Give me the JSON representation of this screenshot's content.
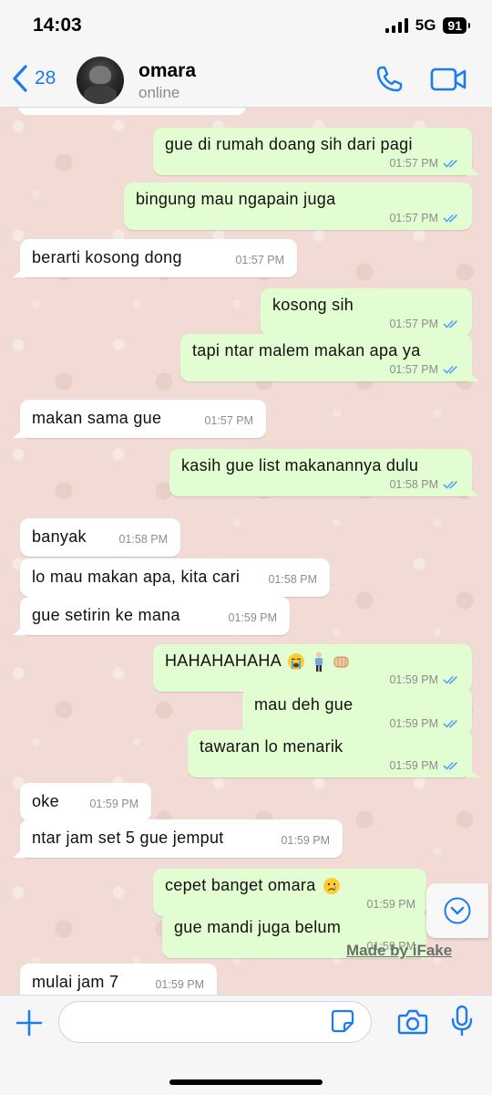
{
  "status_bar": {
    "time": "14:03",
    "network": "5G",
    "battery": "91"
  },
  "header": {
    "back_count": "28",
    "contact_name": "omara",
    "contact_status": "online"
  },
  "messages": [
    {
      "dir": "out",
      "text": "gue di rumah doang sih dari pagi",
      "time": "01:57 PM"
    },
    {
      "dir": "out",
      "text": "bingung mau ngapain juga",
      "time": "01:57 PM"
    },
    {
      "dir": "in",
      "text": "berarti kosong dong",
      "time": "01:57 PM"
    },
    {
      "dir": "out",
      "text": "kosong sih",
      "time": "01:57 PM"
    },
    {
      "dir": "out",
      "text": "tapi ntar malem makan apa ya",
      "time": "01:57 PM"
    },
    {
      "dir": "in",
      "text": "makan sama gue",
      "time": "01:57 PM"
    },
    {
      "dir": "out",
      "text": "kasih gue list makanannya dulu",
      "time": "01:58 PM"
    },
    {
      "dir": "in",
      "text": "banyak",
      "time": "01:58 PM"
    },
    {
      "dir": "in",
      "text": "lo mau makan apa, kita cari",
      "time": "01:58 PM"
    },
    {
      "dir": "in",
      "text": "gue setirin ke mana",
      "time": "01:59 PM"
    },
    {
      "dir": "out",
      "text": "HAHAHAHAHA",
      "time": "01:59 PM",
      "emojis": [
        "loudly-crying-face",
        "person-standing",
        "fist-bump"
      ]
    },
    {
      "dir": "out",
      "text": "mau deh gue",
      "time": "01:59 PM"
    },
    {
      "dir": "out",
      "text": "tawaran lo menarik",
      "time": "01:59 PM"
    },
    {
      "dir": "in",
      "text": "oke",
      "time": "01:59 PM"
    },
    {
      "dir": "in",
      "text": "ntar jam set 5 gue jemput",
      "time": "01:59 PM"
    },
    {
      "dir": "out",
      "text": "cepet banget omara",
      "time": "01:59 PM",
      "emojis": [
        "sad-tear-face"
      ]
    },
    {
      "dir": "out",
      "text": "gue mandi juga belum",
      "time": "01:59 PM"
    },
    {
      "dir": "in",
      "text": "mulai jam 7",
      "time": "01:59 PM"
    }
  ],
  "watermark": "Made by iFake",
  "colors": {
    "outgoing_bubble": "#e2fdd1",
    "incoming_bubble": "#ffffff",
    "accent": "#1a7cf0",
    "read_ticks": "#53a6f4",
    "chat_background": "#f1dbd4"
  },
  "icons": {
    "back": "chevron-left-icon",
    "call": "phone-icon",
    "video": "video-camera-icon",
    "scroll": "chevron-down-circle-icon",
    "attach": "plus-icon",
    "sticker": "sticker-icon",
    "camera": "camera-icon",
    "mic": "microphone-icon"
  }
}
